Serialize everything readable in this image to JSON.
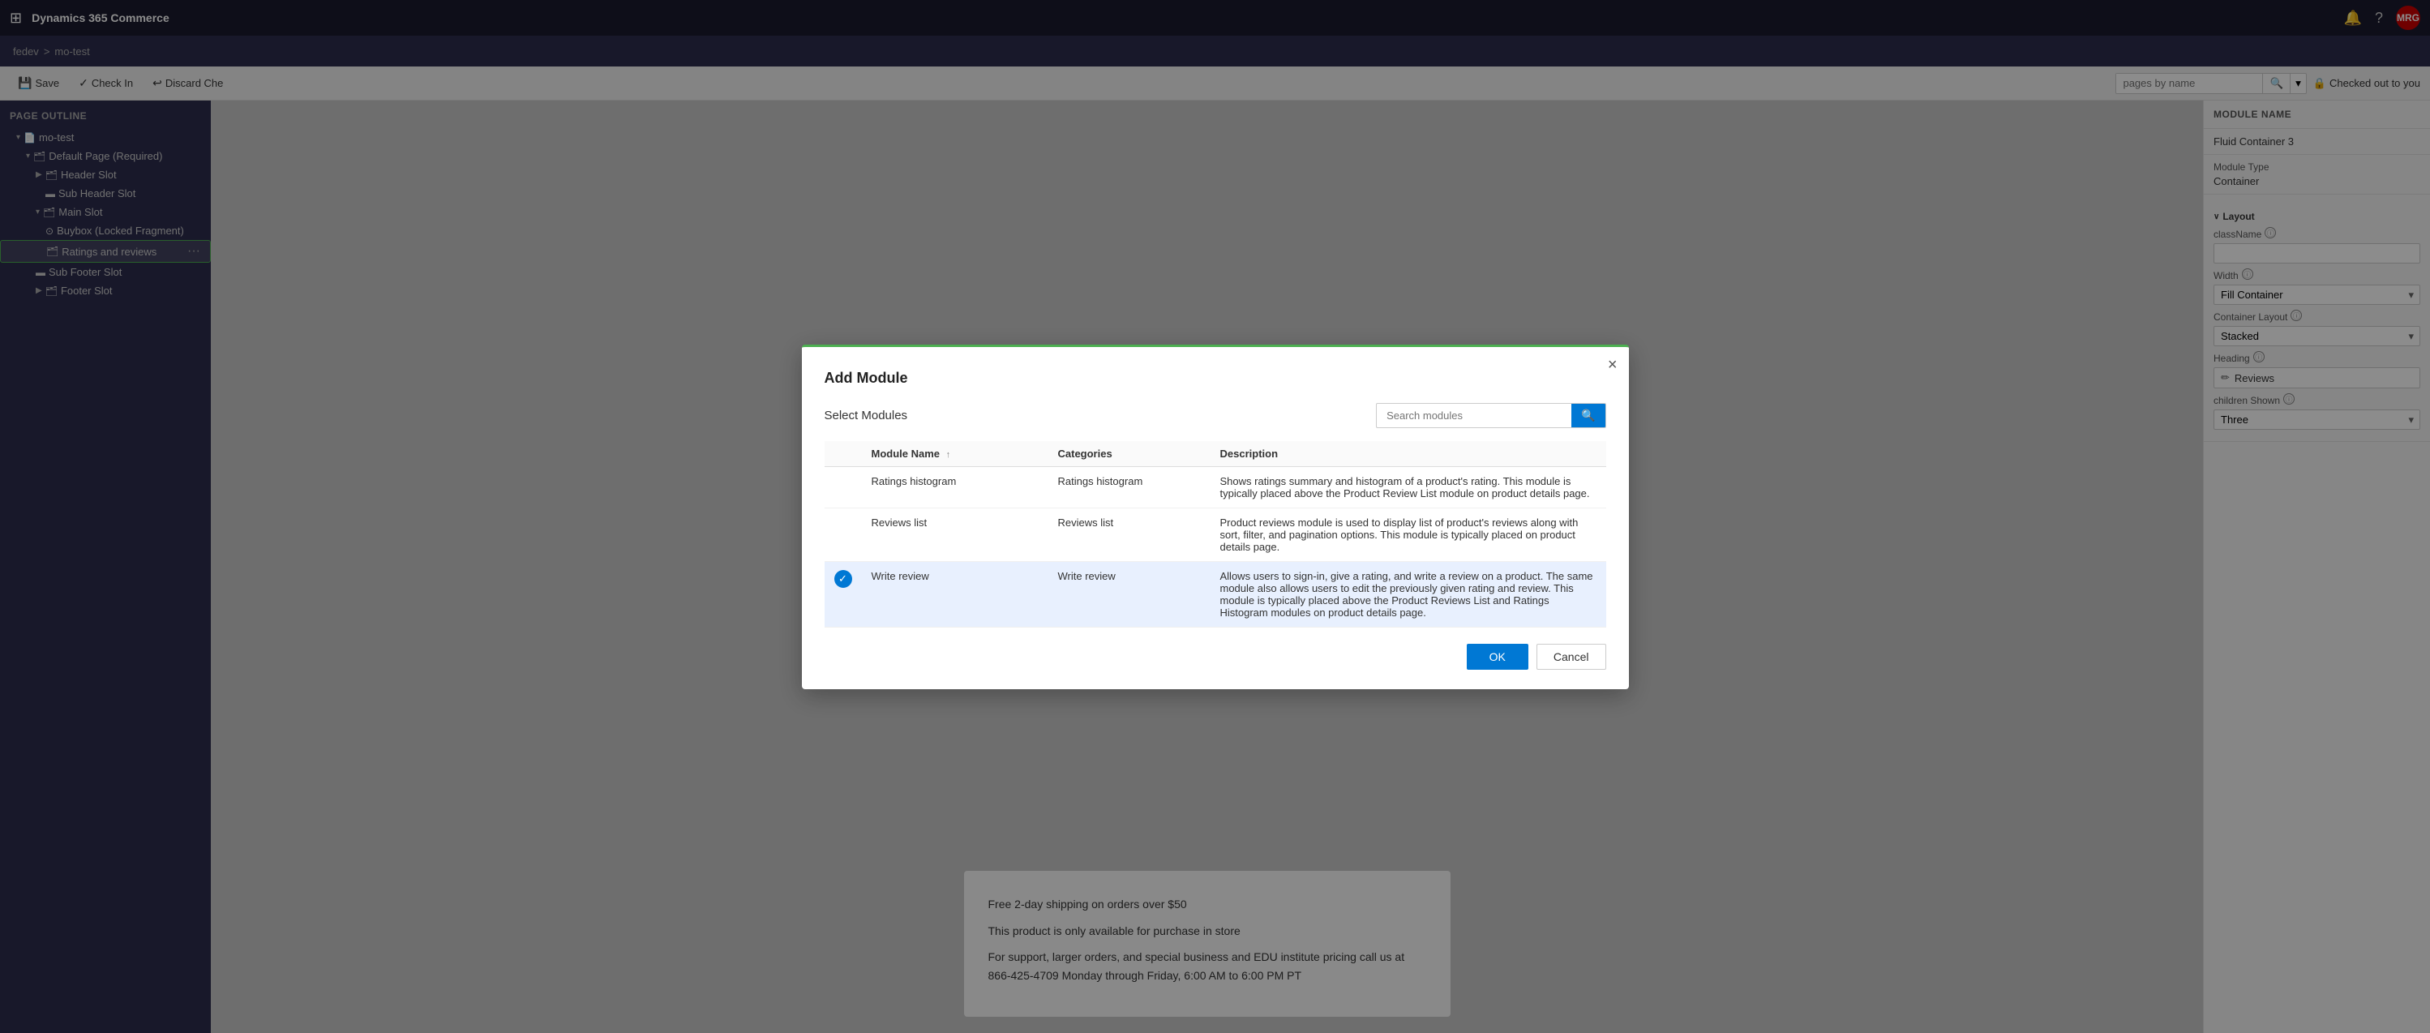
{
  "topNav": {
    "appGrid": "⊞",
    "appName": "Dynamics 365 Commerce",
    "bellIcon": "🔔",
    "helpIcon": "?",
    "avatar": "MRG"
  },
  "subNav": {
    "crumb1": "fedev",
    "separator": ">",
    "crumb2": "mo-test"
  },
  "toolbar": {
    "saveLabel": "Save",
    "checkInLabel": "Check In",
    "discardLabel": "Discard Che",
    "searchPlaceholder": "pages by name",
    "checkedOutLabel": "Checked out to you"
  },
  "pageOutline": {
    "title": "Page Outline",
    "items": [
      {
        "id": "mo-test",
        "label": "mo-test",
        "indent": 1,
        "icon": "📄",
        "expandable": true,
        "expanded": true
      },
      {
        "id": "default-page",
        "label": "Default Page (Required)",
        "indent": 2,
        "icon": "🗂",
        "expandable": true,
        "expanded": true
      },
      {
        "id": "header-slot",
        "label": "Header Slot",
        "indent": 3,
        "icon": "🗂",
        "expandable": true,
        "expanded": false
      },
      {
        "id": "sub-header-slot",
        "label": "Sub Header Slot",
        "indent": 4,
        "icon": "▬",
        "expandable": false
      },
      {
        "id": "main-slot",
        "label": "Main Slot",
        "indent": 3,
        "icon": "🗂",
        "expandable": true,
        "expanded": true
      },
      {
        "id": "buybox",
        "label": "Buybox (Locked Fragment)",
        "indent": 4,
        "icon": "🔗",
        "expandable": false
      },
      {
        "id": "ratings-reviews",
        "label": "Ratings and reviews",
        "indent": 4,
        "icon": "🗂",
        "expandable": false,
        "highlighted": true
      },
      {
        "id": "sub-footer-slot",
        "label": "Sub Footer Slot",
        "indent": 3,
        "icon": "▬",
        "expandable": false
      },
      {
        "id": "footer-slot",
        "label": "Footer Slot",
        "indent": 3,
        "icon": "🗂",
        "expandable": true,
        "expanded": false
      }
    ]
  },
  "previewContent": {
    "line1": "Free 2-day shipping on orders over $50",
    "line2": "This product is only available for purchase in store",
    "line3": "For support, larger orders, and special business and EDU institute pricing call us at 866-425-4709 Monday through Friday, 6:00 AM to 6:00 PM PT"
  },
  "rightPanel": {
    "moduleNameLabel": "MODULE NAME",
    "moduleName": "Fluid Container 3",
    "moduleTypeLabel": "Module Type",
    "moduleType": "Container",
    "layoutSectionLabel": "Layout",
    "layoutChevron": "∨",
    "classNameLabel": "className",
    "widthLabel": "Width",
    "widthValue": "Fill Container",
    "containerLayoutLabel": "Container Layout",
    "containerLayoutValue": "Stacked",
    "headingLabel": "Heading",
    "headingValue": "Reviews",
    "childrenShownLabel": "children Shown",
    "childrenShownValue": "Three",
    "infoIcon": "ⓘ"
  },
  "modal": {
    "title": "Add Module",
    "closeIcon": "×",
    "selectModulesLabel": "Select Modules",
    "searchPlaceholder": "Search modules",
    "searchIcon": "🔍",
    "table": {
      "columns": [
        {
          "id": "check",
          "label": ""
        },
        {
          "id": "name",
          "label": "Module Name"
        },
        {
          "id": "categories",
          "label": "Categories"
        },
        {
          "id": "description",
          "label": "Description"
        }
      ],
      "rows": [
        {
          "id": "ratings-histogram",
          "name": "Ratings histogram",
          "categories": "Ratings histogram",
          "description": "Shows ratings summary and histogram of a product's rating. This module is typically placed above the Product Review List module on product details page.",
          "selected": false
        },
        {
          "id": "reviews-list",
          "name": "Reviews list",
          "categories": "Reviews list",
          "description": "Product reviews module is used to display list of product's reviews along with sort, filter, and pagination options. This module is typically placed on product details page.",
          "selected": false
        },
        {
          "id": "write-review",
          "name": "Write review",
          "categories": "Write review",
          "description": "Allows users to sign-in, give a rating, and write a review on a product. The same module also allows users to edit the previously given rating and review. This module is typically placed above the Product Reviews List and Ratings Histogram modules on product details page.",
          "selected": true
        }
      ]
    },
    "okLabel": "OK",
    "cancelLabel": "Cancel"
  }
}
